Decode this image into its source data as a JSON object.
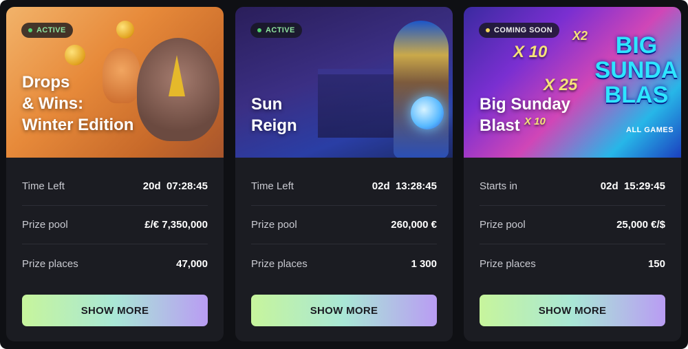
{
  "cards": [
    {
      "badge": "ACTIVE",
      "title_lines": [
        "Drops",
        "& Wins:",
        "Winter Edition"
      ],
      "rows": [
        {
          "label": "Time Left",
          "value": "20d  07:28:45"
        },
        {
          "label": "Prize pool",
          "value": "£/€ 7,350,000"
        },
        {
          "label": "Prize places",
          "value": "47,000"
        }
      ],
      "button": "SHOW MORE"
    },
    {
      "badge": "ACTIVE",
      "title_lines": [
        "Sun",
        "Reign"
      ],
      "rows": [
        {
          "label": "Time Left",
          "value": "02d  13:28:45"
        },
        {
          "label": "Prize pool",
          "value": "260,000 €"
        },
        {
          "label": "Prize places",
          "value": "1 300"
        }
      ],
      "button": "SHOW MORE"
    },
    {
      "badge": "COMING SOON",
      "title_lines": [
        "Big Sunday",
        "Blast"
      ],
      "banner_art": {
        "multipliers": [
          "X 10",
          "X2",
          "X 25",
          "X 10"
        ],
        "logo_lines": [
          "BIG",
          "SUNDA",
          "BLAS"
        ],
        "logo_subtitle": "ALL GAMES"
      },
      "rows": [
        {
          "label": "Starts in",
          "value": "02d  15:29:45"
        },
        {
          "label": "Prize pool",
          "value": "25,000 €/$"
        },
        {
          "label": "Prize places",
          "value": "150"
        }
      ],
      "button": "SHOW MORE"
    }
  ],
  "colors": {
    "page_background": "#0f1014",
    "card_background": "#1b1c22",
    "active_dot": "#53d16f",
    "coming_soon_dot": "#f3d65a",
    "button_gradient_start": "#c7f59c",
    "button_gradient_end": "#b99cf3"
  }
}
